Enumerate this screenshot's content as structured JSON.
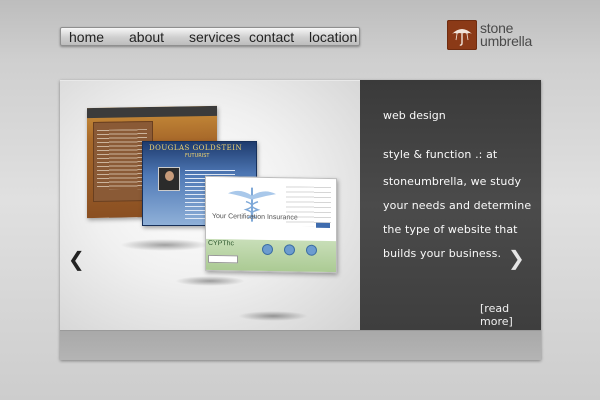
{
  "nav": {
    "items": [
      {
        "label": "home"
      },
      {
        "label": "about"
      },
      {
        "label": "services"
      },
      {
        "label": "contact"
      },
      {
        "label": "location"
      }
    ]
  },
  "logo": {
    "line1": "stone",
    "line2": "umbrella",
    "icon": "umbrella-icon",
    "color": "#8b3a17"
  },
  "slide": {
    "title": "web design",
    "lines": [
      "style & function .: at",
      "stoneumbrella, we study",
      "your needs and determine",
      "the type of website that",
      "builds your business."
    ],
    "read_more": "[read more]",
    "prev_icon": "chevron-left-icon",
    "next_icon": "chevron-right-icon",
    "prev_glyph": "❮",
    "next_glyph": "❯"
  },
  "portfolio": {
    "site2_title": "DOUGLAS GOLDSTEIN",
    "site2_sub": "FUTURIST",
    "site3_brand": "Your Certification Insurance",
    "site3_footer": "CYPThc"
  }
}
